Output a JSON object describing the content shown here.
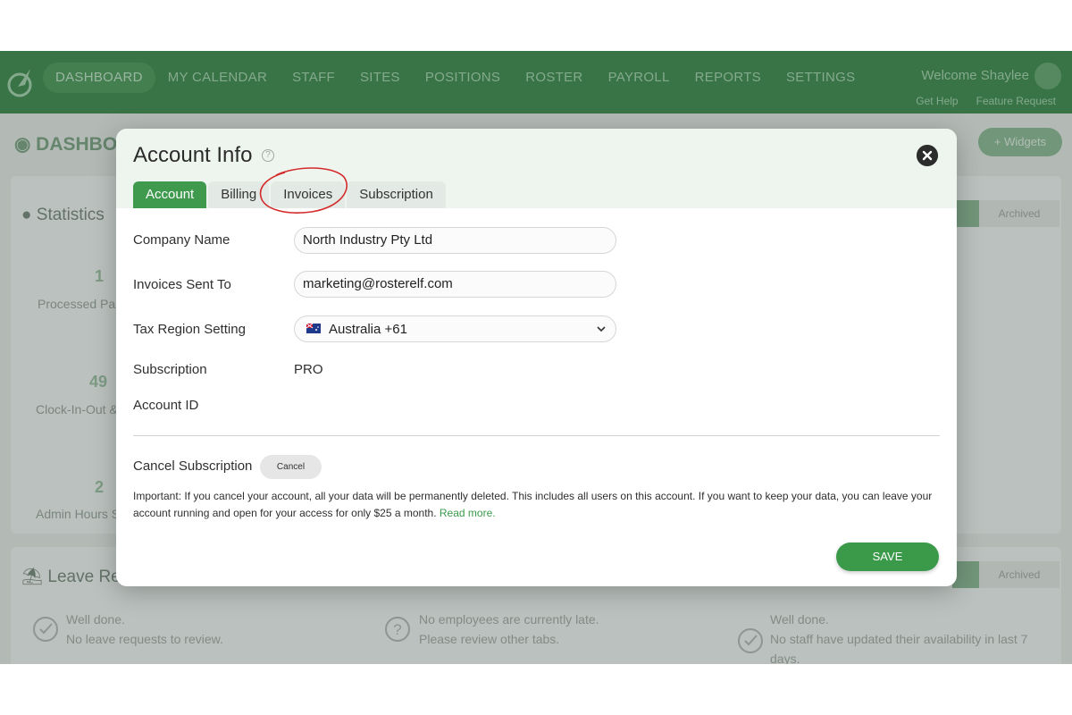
{
  "nav": {
    "items": [
      "DASHBOARD",
      "MY CALENDAR",
      "STAFF",
      "SITES",
      "POSITIONS",
      "ROSTER",
      "PAYROLL",
      "REPORTS",
      "SETTINGS"
    ],
    "active": "DASHBOARD",
    "welcome": "Welcome Shaylee",
    "get_help": "Get Help",
    "feature_request": "Feature Request"
  },
  "background": {
    "page_title": "DASHBO",
    "widgets_label": "+ Widgets",
    "statistics_heading": "Statistics",
    "stats": [
      {
        "value": "1",
        "label": "Processed Pa"
      },
      {
        "value": "49",
        "label": "Clock-In-Out &"
      },
      {
        "value": "2",
        "label": "Admin Hours S"
      }
    ],
    "archived_label": "Archived",
    "leave_heading": "Leave Re",
    "messages": [
      {
        "line1": "Well done.",
        "line2": "No leave requests to review."
      },
      {
        "line1": "No employees are currently late.",
        "line2": "Please review other tabs."
      },
      {
        "line1": "Well done.",
        "line2": "No staff have updated their availability in last 7",
        "line3": "days."
      }
    ]
  },
  "modal": {
    "title": "Account Info",
    "tabs": [
      "Account",
      "Billing",
      "Invoices",
      "Subscription"
    ],
    "active_tab": "Account",
    "fields": {
      "company_name_label": "Company Name",
      "company_name_value": "North Industry Pty Ltd",
      "invoices_sent_to_label": "Invoices Sent To",
      "invoices_sent_to_value": "marketing@rosterelf.com",
      "tax_region_label": "Tax Region Setting",
      "tax_region_value": "Australia +61",
      "subscription_label": "Subscription",
      "subscription_value": "PRO",
      "account_id_label": "Account ID"
    },
    "cancel_subscription_label": "Cancel Subscription",
    "cancel_button": "Cancel",
    "notice": "Important: If you cancel your account, all your data will be permanently deleted. This includes all users on this account. If you want to keep your data, you can leave your account running and open for your access for only $25 a month.",
    "read_more": "Read more.",
    "save_button": "SAVE"
  },
  "colors": {
    "brand_green": "#3f9a4e",
    "annotation_red": "#d42a2a"
  }
}
